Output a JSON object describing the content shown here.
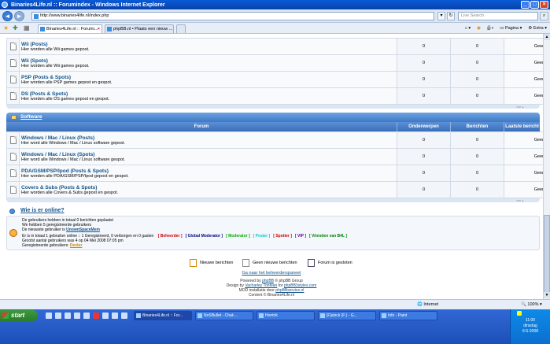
{
  "window": {
    "title": "Binaries4Life.nl :: Forumindex - Windows Internet Explorer"
  },
  "address": {
    "url": "http://www.binaries4life.nl/index.php",
    "search_placeholder": "Live Search"
  },
  "tabs": [
    {
      "label": "Binaries4Life.nl :: Forumi..."
    },
    {
      "label": "phpBB.nl • Plaats een nieuw ..."
    }
  ],
  "commands": {
    "page": "Pagina",
    "extra": "Extra"
  },
  "forums_top": [
    {
      "title": "Wii (Posts)",
      "desc": "Hier worden alle Wii games gepost.",
      "topics": "0",
      "posts": "0",
      "last": "Geen berichten"
    },
    {
      "title": "Wii (Spots)",
      "desc": "Hier worden alle Wii games gepost.",
      "topics": "0",
      "posts": "0",
      "last": "Geen berichten"
    },
    {
      "title": "PSP (Posts & Spots)",
      "desc": "Hier worden alle PSP games gepost en gespot.",
      "topics": "0",
      "posts": "0",
      "last": "Geen berichten"
    },
    {
      "title": "DS (Posts & Spots)",
      "desc": "Hier worden alle DS games gepost en gespot.",
      "topics": "0",
      "posts": "0",
      "last": "Geen berichten"
    }
  ],
  "software": {
    "category": "Software",
    "headers": {
      "forum": "Forum",
      "topics": "Onderwerpen",
      "posts": "Berichten",
      "last": "Laatste bericht"
    },
    "forums": [
      {
        "title": "Windows / Mac / Linux (Posts)",
        "desc": "Hier word alle Windows / Mac / Linux software gepost.",
        "topics": "0",
        "posts": "0",
        "last": "Geen berichten"
      },
      {
        "title": "Windows / Mac / Linux (Spots)",
        "desc": "Hier word alle Windows / Mac / Linux software gespot.",
        "topics": "0",
        "posts": "0",
        "last": "Geen berichten"
      },
      {
        "title": "PDA/GSM/PSP/Ipod (Posts & Spots)",
        "desc": "Hier worden alle PDA/GSM/PSP/Ipod gepost en gespot.",
        "topics": "0",
        "posts": "0",
        "last": "Geen berichten"
      },
      {
        "title": "Covers & Subs (Posts & Spots)",
        "desc": "Hier worden alle Covers & Subs gepost en gespot.",
        "topics": "0",
        "posts": "0",
        "last": "Geen berichten"
      }
    ]
  },
  "online": {
    "title": "Wie is er online?",
    "stats1": "De gebruikers hebben in totaal 0 berichten geplaatst",
    "stats2": "We hebben 5 geregistreerde gebruikers",
    "stats3_prefix": "De nieuwste gebruiker is ",
    "stats3_user": "UnownSpaceMem",
    "online1": "Er is in totaal 1 gebruiker online :: 1 Geregistreerd, 0 verborgen en 0 gasten",
    "online2": "Grootst aantal gebruikers was 4 op 04 Mei 2008 07:05 pm",
    "online3_prefix": "Geregistreerde gebruikers: ",
    "online3_user": "Dexter",
    "groups": [
      {
        "name": "Beheerder",
        "color": "#cc0000"
      },
      {
        "name": "Global Moderator",
        "color": "#000080"
      },
      {
        "name": "Moderator",
        "color": "#00aa00"
      },
      {
        "name": "Poster",
        "color": "#00cccc"
      },
      {
        "name": "Spotter",
        "color": "#cc0000"
      },
      {
        "name": "VIP",
        "color": "#660099"
      },
      {
        "name": "Vrienden van B4L",
        "color": "#008000"
      }
    ]
  },
  "legend": {
    "new": "Nieuwe berichten",
    "no_new": "Geen nieuwe berichten",
    "locked": "Forum is gesloten"
  },
  "admin_link": "Ga naar het beheerderspaneel",
  "footer": {
    "powered_prefix": "Powered by ",
    "phpbb": "phpBB",
    "powered_suffix": " © phpBB Group",
    "design_prefix": "Design by ",
    "designer": "Vacharley TonMan",
    "design_mid": " for ",
    "styles": "phpBB3styles.com",
    "mod_prefix": "MOD installatie door ",
    "mod": "phpBBservice.nl",
    "content": "Content © Binaries4Life.nl"
  },
  "status": {
    "text": "",
    "zone": "Internet",
    "zoom": "100%"
  },
  "taskbar": {
    "start": "start",
    "buttons": [
      "Binaries4Life.nl :: For...",
      "NoSBullet - Chat-...",
      "Hentrik",
      "[F]alsck (F:) - G...",
      "Info - Paint"
    ],
    "clock": "11:00",
    "day": "dinsdag",
    "date": "6-5-2008"
  }
}
